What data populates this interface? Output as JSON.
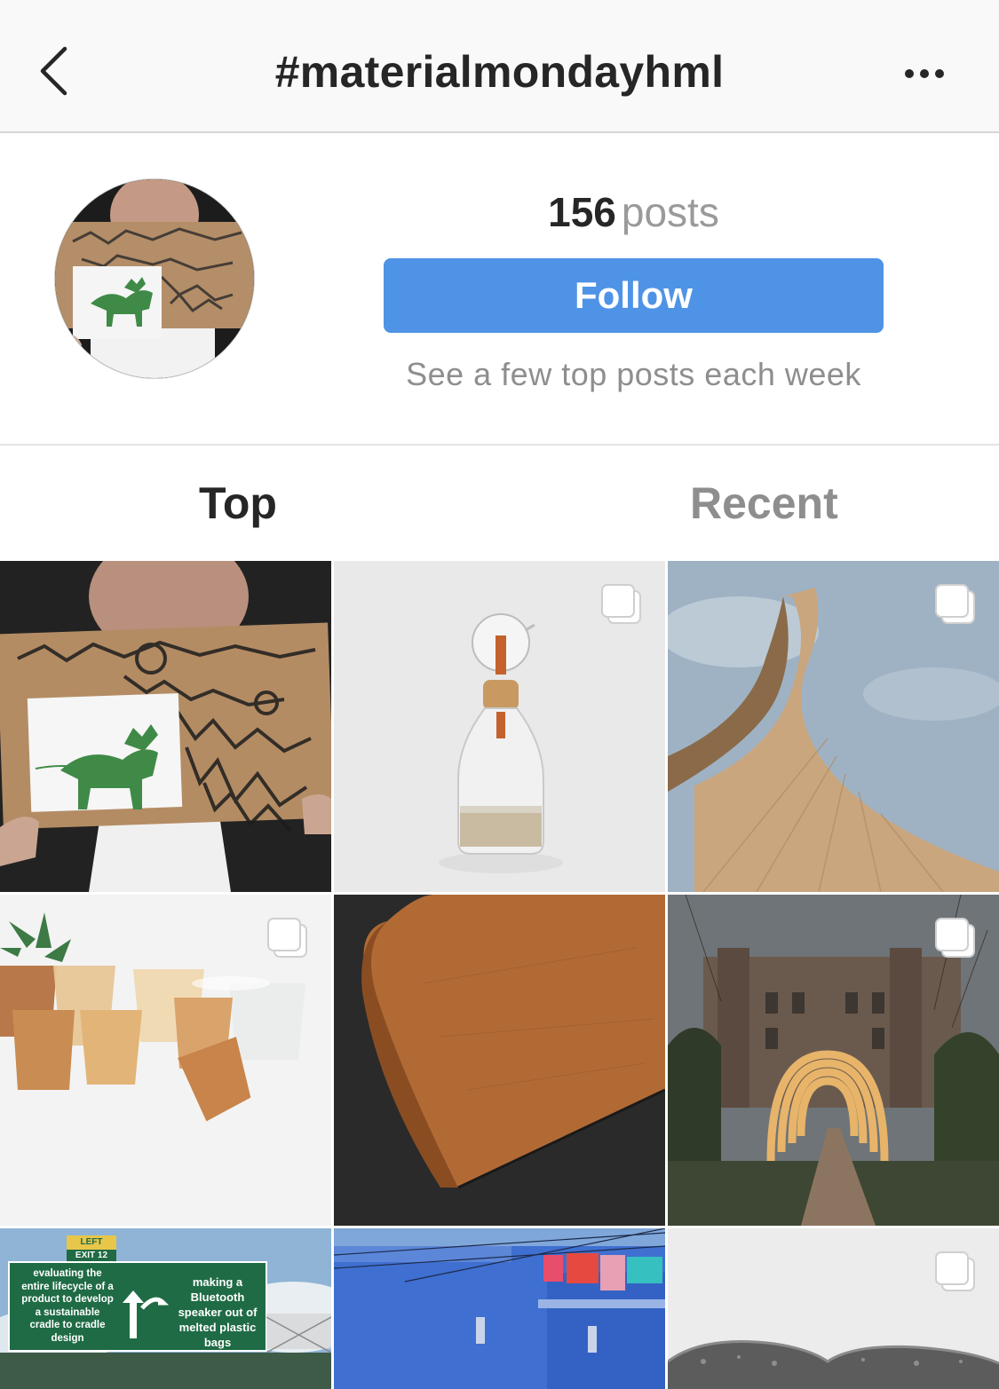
{
  "header": {
    "title": "#materialmondayhml"
  },
  "profile": {
    "posts_count": "156",
    "posts_label": "posts",
    "follow_label": "Follow",
    "subtitle": "See a few top posts each week"
  },
  "tabs": [
    {
      "label": "Top",
      "selected": true
    },
    {
      "label": "Recent",
      "selected": false
    }
  ],
  "grid": {
    "tiles": [
      {
        "name": "cardboard-thank-you-card",
        "multi": false
      },
      {
        "name": "glass-bottle-cork",
        "multi": true
      },
      {
        "name": "wooden-tower",
        "multi": true
      },
      {
        "name": "translucent-cups",
        "multi": true
      },
      {
        "name": "leather-sheet",
        "multi": false
      },
      {
        "name": "arch-pavilion",
        "multi": true
      },
      {
        "name": "highway-sign",
        "multi": false,
        "sign_top": "LEFT",
        "sign_exit": "EXIT 12",
        "sign_left_text": [
          "evaluating the",
          "entire lifecycle of a",
          "product to develop",
          "a sustainable",
          "cradle to cradle",
          "design"
        ],
        "sign_right_text": [
          "making a",
          "Bluetooth",
          "speaker out of",
          "melted plastic",
          "bags"
        ]
      },
      {
        "name": "blue-building",
        "multi": false
      },
      {
        "name": "grey-stone-object",
        "multi": true
      }
    ]
  },
  "colors": {
    "follow_button": "#4f93e6",
    "muted_text": "#8e8e8e"
  }
}
